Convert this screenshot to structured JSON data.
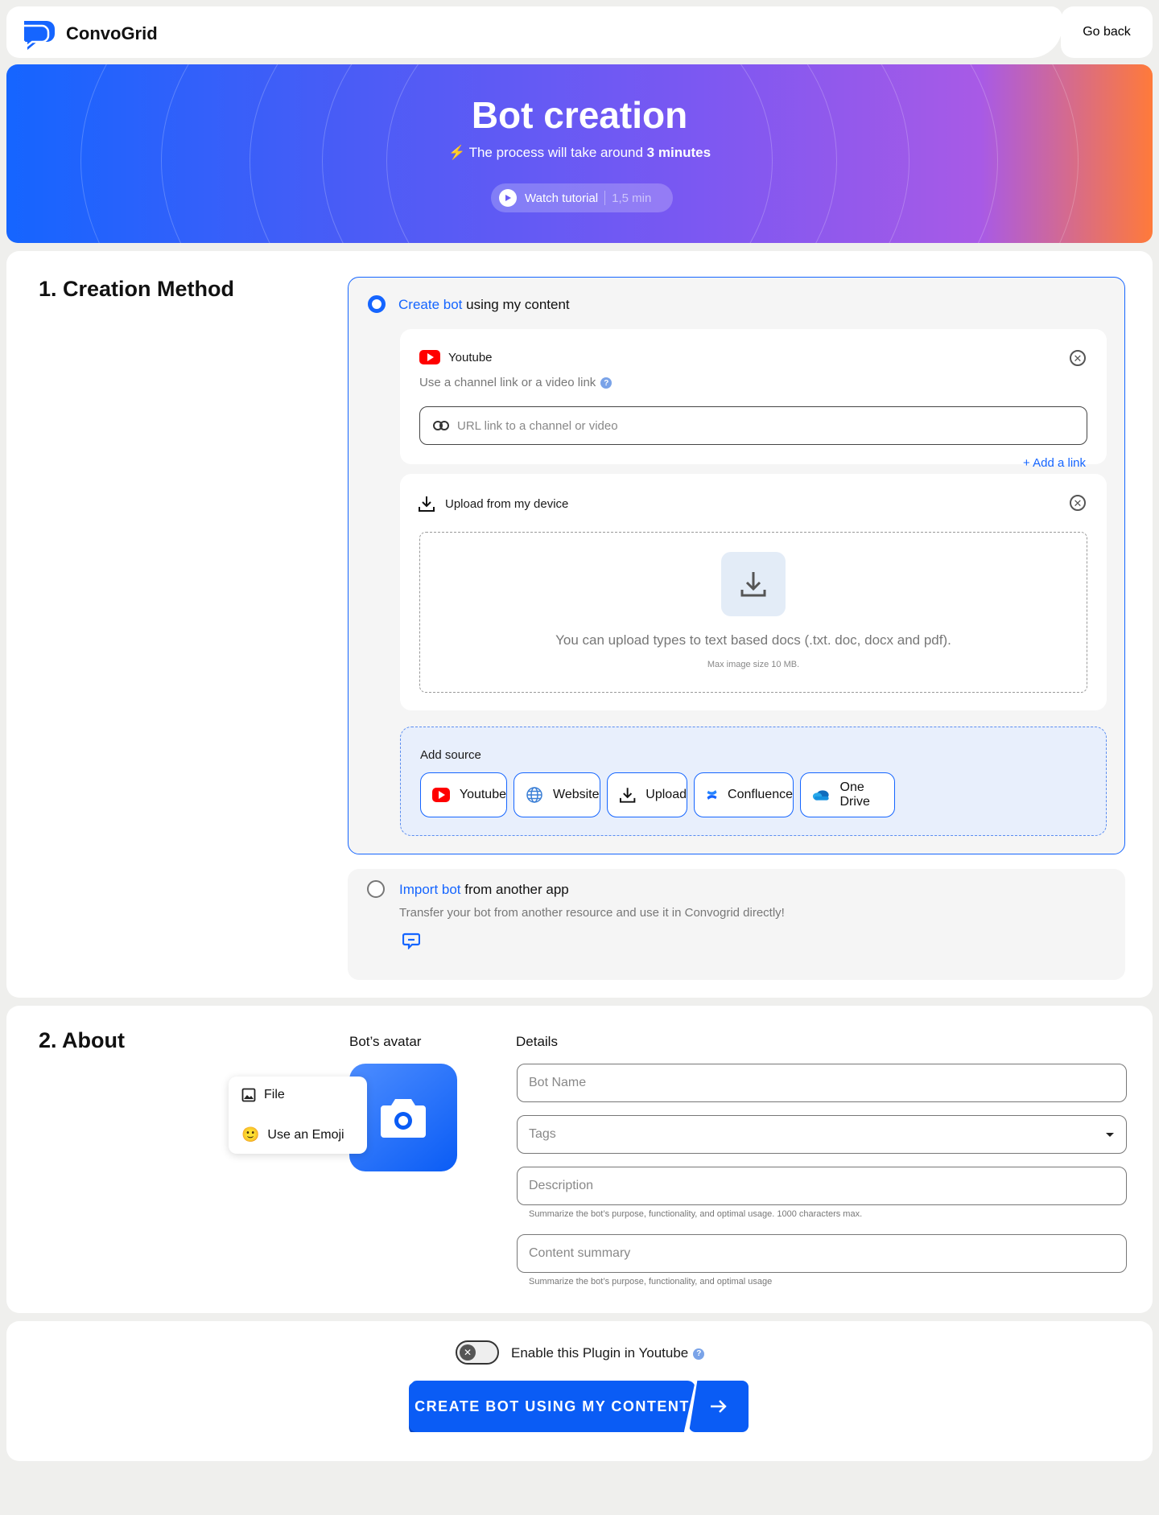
{
  "header": {
    "brand": "ConvoGrid",
    "go_back": "Go back"
  },
  "hero": {
    "title": "Bot creation",
    "sub_prefix": "The process will take around ",
    "sub_bold": "3 minutes",
    "watch_label": "Watch tutorial",
    "watch_duration": "1,5 min"
  },
  "section1": {
    "title": "1. Creation Method",
    "option1": {
      "title_hl": "Create bot",
      "title_rest": " using my content"
    },
    "youtube": {
      "label": "Youtube",
      "hint": "Use a channel link or a video link",
      "placeholder": "URL link to a channel or video",
      "add_link": "+ Add a link"
    },
    "upload": {
      "label": "Upload from my device",
      "text": "You can upload types to text based docs (.txt. doc, docx and pdf).",
      "max": "Max image size 10 MB."
    },
    "add_source": {
      "title": "Add source",
      "buttons": [
        "Youtube",
        "Website",
        "Upload",
        "Confluence",
        "One Drive"
      ]
    },
    "option2": {
      "title_hl": "Import bot",
      "title_rest": " from another app",
      "desc": "Transfer your bot from another resource and use it in Convogrid directly!"
    }
  },
  "section2": {
    "title": "2. About",
    "avatar_label": "Bot’s avatar",
    "menu": {
      "file": "File",
      "emoji": "Use an Emoji"
    },
    "details_label": "Details",
    "fields": {
      "name": "Bot Name",
      "tags": "Tags",
      "description": "Description",
      "content_summary": "Content summary"
    },
    "hints": {
      "description": "Summarize the bot’s purpose, functionality, and optimal usage. 1000 characters max.",
      "summary": "Summarize the bot’s purpose, functionality, and optimal usage"
    }
  },
  "footer": {
    "toggle_label": "Enable this Plugin in Youtube",
    "create_label": "CREATE BOT USING MY CONTENT"
  },
  "colors": {
    "accent": "#1565ff",
    "youtube": "#ff0000"
  }
}
